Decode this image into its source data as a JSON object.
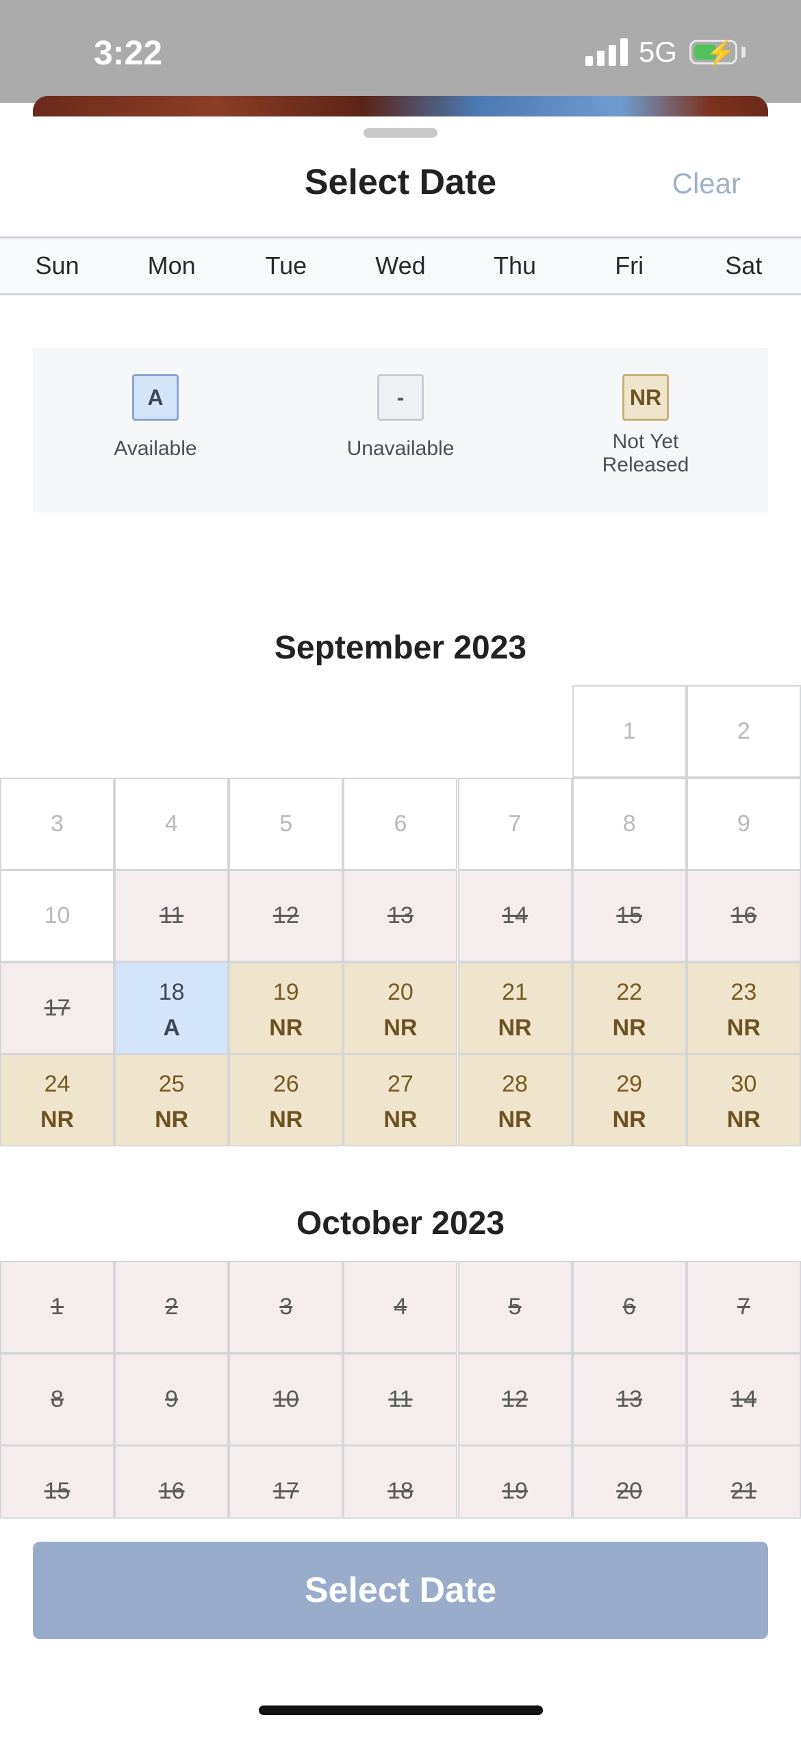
{
  "status_bar": {
    "time": "3:22",
    "network": "5G"
  },
  "header": {
    "title": "Select Date",
    "clear_label": "Clear"
  },
  "weekdays": [
    "Sun",
    "Mon",
    "Tue",
    "Wed",
    "Thu",
    "Fri",
    "Sat"
  ],
  "legend": [
    {
      "code": "A",
      "label": "Available"
    },
    {
      "code": "-",
      "label": "Unavailable"
    },
    {
      "code": "NR",
      "label": "Not Yet Released"
    }
  ],
  "months": [
    {
      "title": "September 2023",
      "days": [
        {
          "day": "1",
          "state": "plain"
        },
        {
          "day": "2",
          "state": "plain"
        },
        {
          "day": "3",
          "state": "plain"
        },
        {
          "day": "4",
          "state": "plain"
        },
        {
          "day": "5",
          "state": "plain"
        },
        {
          "day": "6",
          "state": "plain"
        },
        {
          "day": "7",
          "state": "plain"
        },
        {
          "day": "8",
          "state": "plain"
        },
        {
          "day": "9",
          "state": "plain"
        },
        {
          "day": "10",
          "state": "plain"
        },
        {
          "day": "11",
          "state": "unavailable"
        },
        {
          "day": "12",
          "state": "unavailable"
        },
        {
          "day": "13",
          "state": "unavailable"
        },
        {
          "day": "14",
          "state": "unavailable"
        },
        {
          "day": "15",
          "state": "unavailable"
        },
        {
          "day": "16",
          "state": "unavailable"
        },
        {
          "day": "17",
          "state": "unavailable"
        },
        {
          "day": "18",
          "state": "available",
          "status": "A"
        },
        {
          "day": "19",
          "state": "not-released",
          "status": "NR"
        },
        {
          "day": "20",
          "state": "not-released",
          "status": "NR"
        },
        {
          "day": "21",
          "state": "not-released",
          "status": "NR"
        },
        {
          "day": "22",
          "state": "not-released",
          "status": "NR"
        },
        {
          "day": "23",
          "state": "not-released",
          "status": "NR"
        },
        {
          "day": "24",
          "state": "not-released",
          "status": "NR"
        },
        {
          "day": "25",
          "state": "not-released",
          "status": "NR"
        },
        {
          "day": "26",
          "state": "not-released",
          "status": "NR"
        },
        {
          "day": "27",
          "state": "not-released",
          "status": "NR"
        },
        {
          "day": "28",
          "state": "not-released",
          "status": "NR"
        },
        {
          "day": "29",
          "state": "not-released",
          "status": "NR"
        },
        {
          "day": "30",
          "state": "not-released",
          "status": "NR"
        }
      ]
    },
    {
      "title": "October 2023",
      "days": [
        {
          "day": "1",
          "state": "unavailable"
        },
        {
          "day": "2",
          "state": "unavailable"
        },
        {
          "day": "3",
          "state": "unavailable"
        },
        {
          "day": "4",
          "state": "unavailable"
        },
        {
          "day": "5",
          "state": "unavailable"
        },
        {
          "day": "6",
          "state": "unavailable"
        },
        {
          "day": "7",
          "state": "unavailable"
        },
        {
          "day": "8",
          "state": "unavailable"
        },
        {
          "day": "9",
          "state": "unavailable"
        },
        {
          "day": "10",
          "state": "unavailable"
        },
        {
          "day": "11",
          "state": "unavailable"
        },
        {
          "day": "12",
          "state": "unavailable"
        },
        {
          "day": "13",
          "state": "unavailable"
        },
        {
          "day": "14",
          "state": "unavailable"
        },
        {
          "day": "15",
          "state": "unavailable"
        },
        {
          "day": "16",
          "state": "unavailable"
        },
        {
          "day": "17",
          "state": "unavailable"
        },
        {
          "day": "18",
          "state": "unavailable"
        },
        {
          "day": "19",
          "state": "unavailable"
        },
        {
          "day": "20",
          "state": "unavailable"
        },
        {
          "day": "21",
          "state": "unavailable"
        }
      ]
    }
  ],
  "footer": {
    "button_label": "Select Date"
  },
  "colors": {
    "available": "#d3e5f8",
    "unavailable": "#f5eced",
    "not_released": "#efe4cc",
    "button": "#9aaccc"
  }
}
